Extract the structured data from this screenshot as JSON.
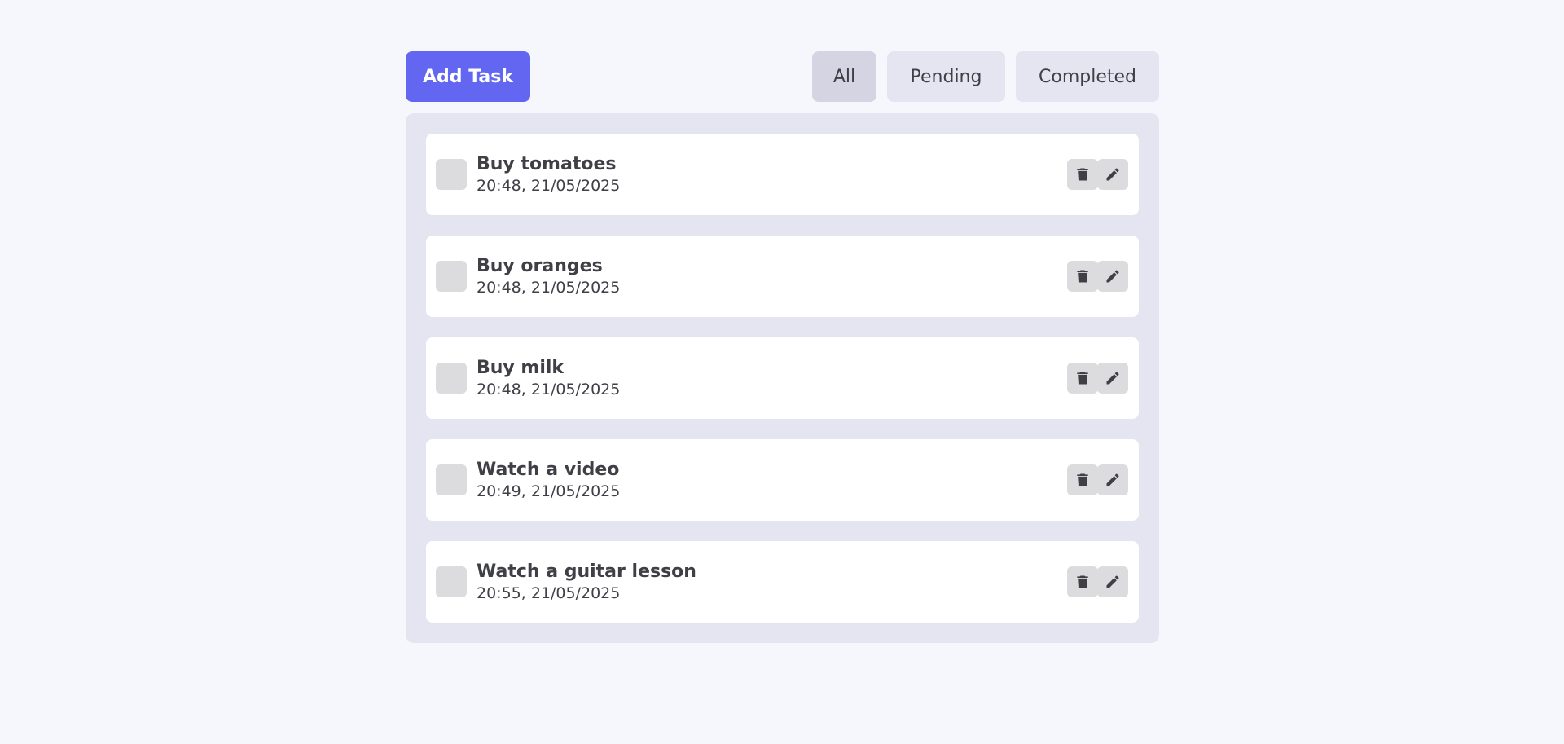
{
  "toolbar": {
    "add_label": "Add Task",
    "filters": [
      {
        "label": "All",
        "active": true
      },
      {
        "label": "Pending",
        "active": false
      },
      {
        "label": "Completed",
        "active": false
      }
    ]
  },
  "tasks": [
    {
      "title": "Buy tomatoes",
      "time": "20:48, 21/05/2025",
      "checked": false
    },
    {
      "title": "Buy oranges",
      "time": "20:48, 21/05/2025",
      "checked": false
    },
    {
      "title": "Buy milk",
      "time": "20:48, 21/05/2025",
      "checked": false
    },
    {
      "title": "Watch a video",
      "time": "20:49, 21/05/2025",
      "checked": false
    },
    {
      "title": "Watch a guitar lesson",
      "time": "20:55, 21/05/2025",
      "checked": false
    }
  ],
  "icons": {
    "delete": "trash-icon",
    "edit": "pencil-icon"
  },
  "colors": {
    "accent": "#6366f1",
    "background": "#f6f7fd",
    "panel": "#e5e5f1",
    "active_filter": "#d4d4e3"
  }
}
